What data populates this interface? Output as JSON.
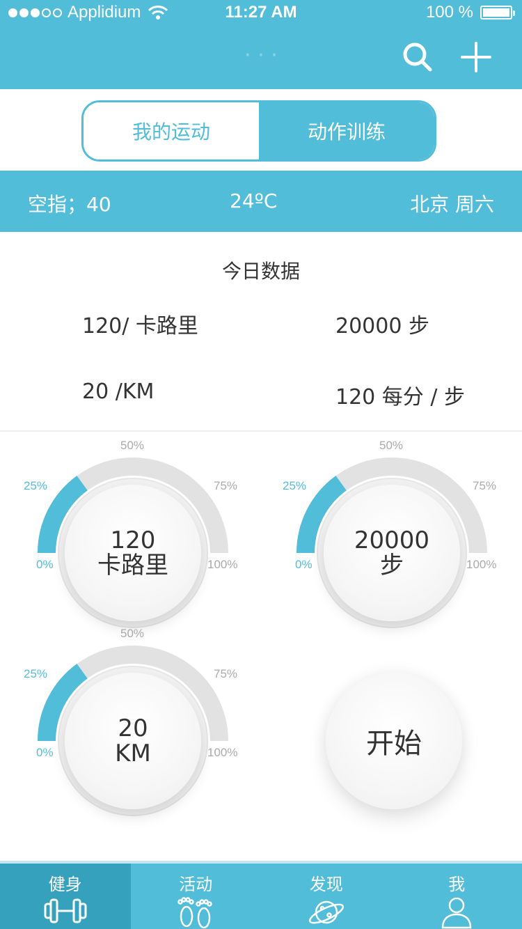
{
  "status_bar": {
    "carrier": "Applidium",
    "time": "11:27 AM",
    "battery": "100 %"
  },
  "nav": {
    "title": "· · ·",
    "search_icon": "search-icon",
    "add_icon": "plus-icon"
  },
  "segments": {
    "my_sports": "我的运动",
    "training": "动作训练"
  },
  "info": {
    "aqi": "空指；40",
    "temp": "24ºC",
    "city_day": "北京  周六"
  },
  "today": {
    "title": "今日数据",
    "calories": "120/ 卡路里",
    "steps": "20000 步",
    "distance": "20 /KM",
    "pace": "120 每分 / 步"
  },
  "gauges": [
    {
      "line1": "120",
      "line2": "卡路里",
      "progress": 0.15,
      "p0": "0%",
      "p25": "25%",
      "p50": "50%",
      "p75": "75%",
      "p100": "100%"
    },
    {
      "line1": "20000",
      "line2": "步",
      "progress": 0.15,
      "p0": "0%",
      "p25": "25%",
      "p50": "50%",
      "p75": "75%",
      "p100": "100%"
    },
    {
      "line1": "20",
      "line2": "KM",
      "progress": 0.15,
      "p0": "0%",
      "p25": "25%",
      "p50": "50%",
      "p75": "75%",
      "p100": "100%"
    }
  ],
  "start_label": "开始",
  "tabs": [
    {
      "label": "健身",
      "icon": "dumbbell-icon"
    },
    {
      "label": "活动",
      "icon": "footprints-icon"
    },
    {
      "label": "发现",
      "icon": "planet-icon"
    },
    {
      "label": "我",
      "icon": "user-icon"
    }
  ],
  "colors": {
    "accent": "#51bdd9",
    "accent_dark": "#35a1bd",
    "track": "#e2e2e2"
  }
}
